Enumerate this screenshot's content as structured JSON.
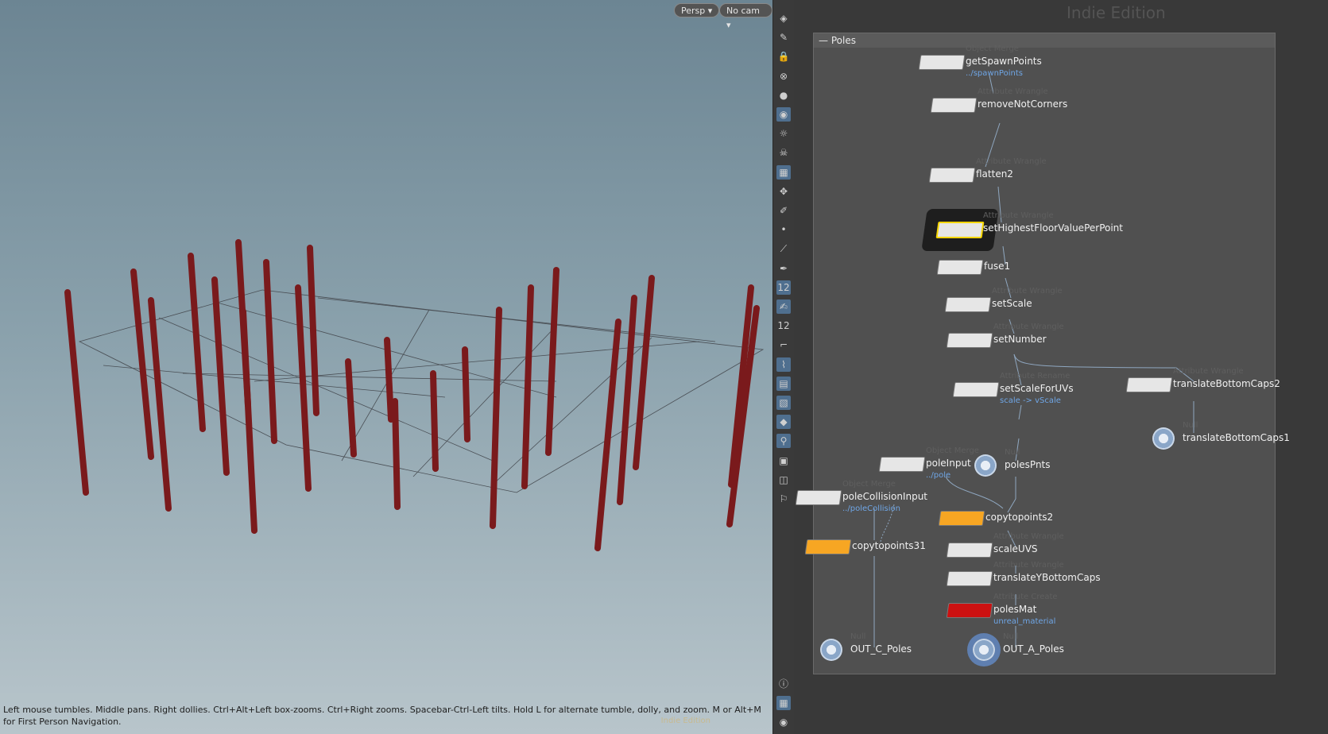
{
  "viewport": {
    "persp_label": "Persp ▾",
    "cam_label": "No cam ▾",
    "hint_text": "Left mouse tumbles. Middle pans. Right dollies. Ctrl+Alt+Left box-zooms. Ctrl+Right zooms. Spacebar-Ctrl-Left tilts. Hold L for alternate tumble, dolly, and zoom.     M or Alt+M for First Person Navigation.",
    "hint_right": "Indie Edition"
  },
  "network": {
    "edition_label": "Indie Edition",
    "box_title": "Poles",
    "nodes": [
      {
        "name": "getSpawnPoints",
        "type": "Object Merge",
        "sub": "../spawnPoints"
      },
      {
        "name": "removeNotCorners",
        "type": "Attribute Wrangle",
        "sub": ""
      },
      {
        "name": "flatten2",
        "type": "Attribute Wrangle",
        "sub": ""
      },
      {
        "name": "setHighestFloorValuePerPoint",
        "type": "Attribute Wrangle",
        "sub": ""
      },
      {
        "name": "fuse1",
        "type": "",
        "sub": ""
      },
      {
        "name": "setScale",
        "type": "Attribute Wrangle",
        "sub": ""
      },
      {
        "name": "setNumber",
        "type": "Attribute Wrangle",
        "sub": ""
      },
      {
        "name": "setScaleForUVs",
        "type": "Attribute Rename",
        "sub": "scale -> vScale"
      },
      {
        "name": "translateBottomCaps2",
        "type": "Attribute Wrangle",
        "sub": ""
      },
      {
        "name": "translateBottomCaps1",
        "type": "Null",
        "sub": ""
      },
      {
        "name": "poleInput",
        "type": "Object Merge",
        "sub": "../pole"
      },
      {
        "name": "polesPnts",
        "type": "Null",
        "sub": ""
      },
      {
        "name": "poleCollisionInput",
        "type": "Object Merge",
        "sub": "../poleCollision"
      },
      {
        "name": "copytopoints2",
        "type": "",
        "sub": ""
      },
      {
        "name": "copytopoints31",
        "type": "",
        "sub": ""
      },
      {
        "name": "scaleUVS",
        "type": "Attribute Wrangle",
        "sub": ""
      },
      {
        "name": "translateYBottomCaps",
        "type": "Attribute Wrangle",
        "sub": ""
      },
      {
        "name": "polesMat",
        "type": "Attribute Create",
        "sub": "unreal_material"
      },
      {
        "name": "OUT_C_Poles",
        "type": "Null",
        "sub": ""
      },
      {
        "name": "OUT_A_Poles",
        "type": "Null",
        "sub": ""
      }
    ]
  },
  "toolbar_icons": [
    "select-icon",
    "transform-icon",
    "lock-icon",
    "snap-icon",
    "sphere-icon",
    "camera-icon",
    "light-icon",
    "skeleton-icon",
    "display-icon",
    "handle-icon",
    "brush-icon",
    "point-icon",
    "edge-icon",
    "pen-icon",
    "number-icon",
    "paint-icon",
    "number2-icon",
    "corner-icon",
    "wire-icon",
    "grid-icon",
    "layers-icon",
    "material-icon",
    "snap2-icon",
    "box-icon",
    "view-icon",
    "pin-icon"
  ],
  "bottom_icons": [
    "info-icon",
    "layout-icon",
    "eye-icon"
  ]
}
